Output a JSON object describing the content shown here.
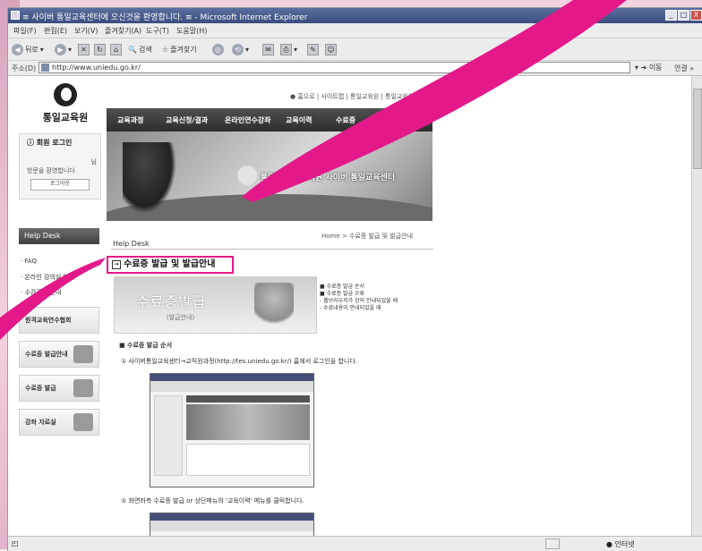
{
  "window": {
    "title": "≡ 사이버 통일교육센터에 오신것을 환영합니다. ≡ - Microsoft Internet Explorer",
    "controls": [
      "_",
      "□",
      "X"
    ]
  },
  "menu": [
    "파일(F)",
    "편집(E)",
    "보기(V)",
    "즐겨찾기(A)",
    "도구(T)",
    "도움말(H)"
  ],
  "toolbar": {
    "back_label": "뒤로",
    "search_label": "검색",
    "favorites_label": "즐겨찾기"
  },
  "address": {
    "label": "주소(D)",
    "url": "http://www.uniedu.go.kr/",
    "go_label": "이동",
    "links_label": "연결 »"
  },
  "site": {
    "logo_text": "통일교육원",
    "top_links": "● 홈으로 | 사이트맵 | 통일교육원 | 통일교육원 | 영문",
    "gnb": [
      "교육과정",
      "교육신청/결과",
      "온라인연수강좌",
      "교육이력",
      "수료증",
      "Help Desk"
    ],
    "login": {
      "title": "회원 로그인",
      "welcome_suffix": "님",
      "welcome_text": "방문을 환영합니다",
      "logout_button": "로그아웃"
    },
    "banner_text": "통일부 통일교육원 사이버 통일교육센터",
    "side_nav": {
      "head": "Help Desk",
      "items": [
        "FAQ",
        "온라인 강의실 안내",
        "수강관련 안내"
      ]
    },
    "side_banners": [
      "원격교육연수협회",
      "수료증 발급안내",
      "수료증 발급",
      "강좌 자료실"
    ],
    "breadcrumb": "Home > 수료증 발급 및 발급안내",
    "section_label": "Help Desk",
    "heading": "수료증 발급 및 발급안내",
    "cert_banner": {
      "title": "수료증발급",
      "subtitle": "(발급안내)"
    },
    "toc": [
      "■ 수료증 발급 순서",
      "■ 수료증 발급 오류",
      "- 웹브라우저가 강의 안내되었을 때",
      "- 수료내용이 안내되었을 때"
    ],
    "content": {
      "section_title": "■ 수료증 발급 순서",
      "step1": "① 사이버통일교육센터→교직원과정(http://tes.uniedu.go.kr/) 홈에서 로그인을 합니다.",
      "step2": "② 화면좌측 수료증 발급 or 상단메뉴의 '교육이력' 메뉴를 클릭합니다."
    }
  },
  "status": {
    "zone": "인터넷"
  },
  "colors": {
    "highlight": "#e3198a",
    "titlebar": "#3b4d7e"
  }
}
